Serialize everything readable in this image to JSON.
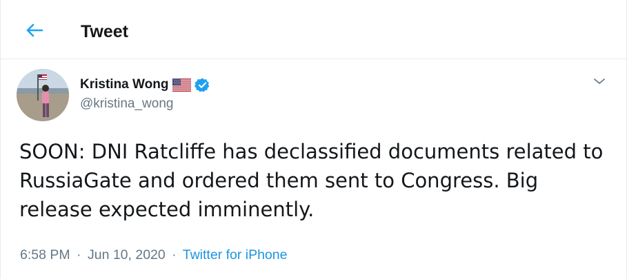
{
  "header": {
    "title": "Tweet",
    "back_icon": "arrow-left-icon"
  },
  "tweet": {
    "author": {
      "name": "Kristina Wong",
      "handle": "@kristina_wong",
      "flag_icon": "us-flag-icon",
      "verified_icon": "verified-badge-icon"
    },
    "text": "SOON: DNI Ratcliffe has declassified documents related to RussiaGate and ordered them sent to Congress. Big release expected imminently.",
    "time": "6:58 PM",
    "date": "Jun 10, 2020",
    "separator": "·",
    "source": "Twitter for iPhone"
  },
  "colors": {
    "accent": "#1da1f2",
    "link": "#1b95e0",
    "muted": "#657786",
    "border": "#e6ecf0",
    "text": "#14171a"
  }
}
